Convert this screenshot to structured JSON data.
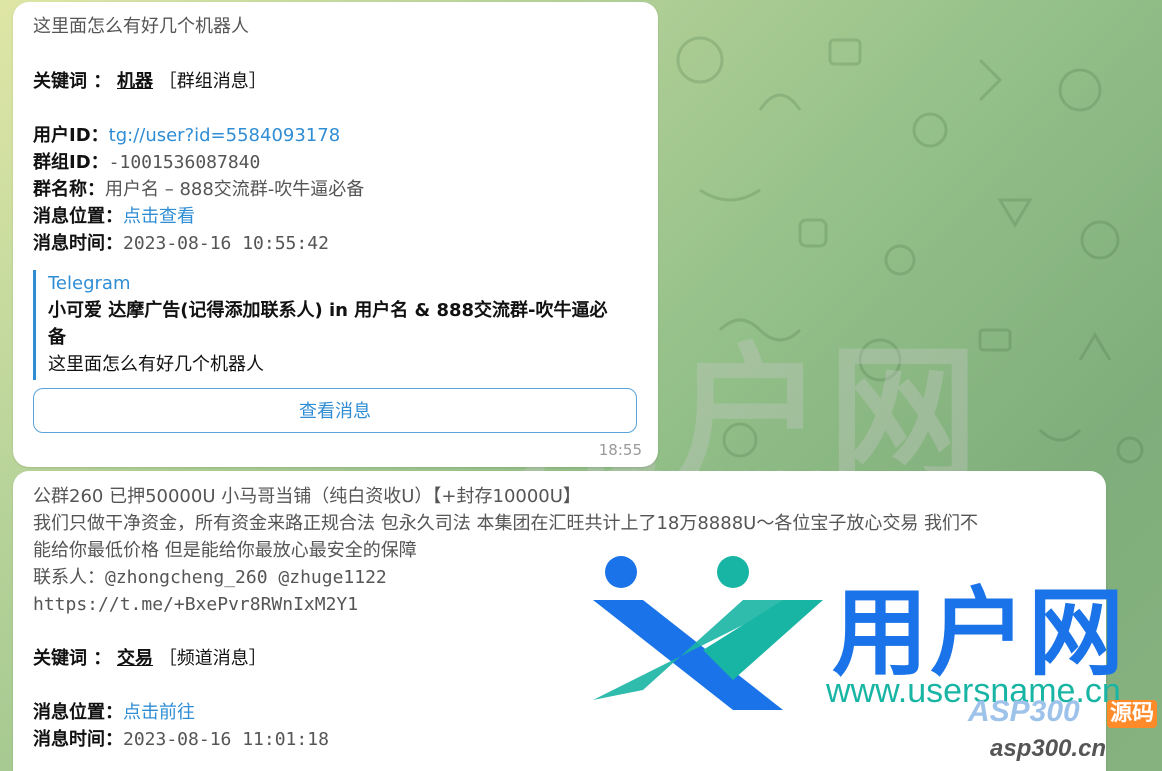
{
  "msg1": {
    "text": "这里面怎么有好几个机器人",
    "kw_label": "关键词 ：",
    "kw_value": "机器",
    "kw_type": "［群组消息］",
    "uid_label": "用户ID：",
    "uid_value": "tg://user?id=5584093178",
    "gid_label": "群组ID：",
    "gid_value": "-1001536087840",
    "gname_label": "群名称：",
    "gname_value": "用户名 – 888交流群-吹牛逼必备",
    "pos_label": "消息位置：",
    "pos_value": "点击查看",
    "time_label": "消息时间：",
    "time_value": "2023-08-16 10:55:42",
    "quote_title": "Telegram",
    "quote_line1": "小可爱 达摩广告(记得添加联系人) in 用户名 & 888交流群-吹牛逼必",
    "quote_line2": "备",
    "quote_text": "这里面怎么有好几个机器人",
    "button": "查看消息",
    "timestamp": "18:55"
  },
  "msg2": {
    "line1": "公群260 已押50000U 小马哥当铺（纯白资收U）【+封存10000U】",
    "line2": "我们只做干净资金，所有资金来路正规合法 包永久司法 本集团在汇旺共计上了18万8888U～各位宝子放心交易 我们不",
    "line3": "能给你最低价格 但是能给你最放心最安全的保障",
    "line4": "联系人：@zhongcheng_260 @zhuge1122",
    "line5": "https://t.me/+BxePvr8RWnIxM2Y1",
    "kw_label": "关键词 ：",
    "kw_value": "交易",
    "kw_type": "［频道消息］",
    "pos_label": "消息位置：",
    "pos_value": "点击前往",
    "time_label": "消息时间：",
    "time_value": "2023-08-16 11:01:18"
  },
  "watermark": {
    "big": "用户网",
    "url": "www.usersname.cn",
    "logo_text": "用户网",
    "logo_url": "www.usersname.cn",
    "asp": "ASP300",
    "asp_badge": "源码",
    "asp_url": "asp300.cn"
  },
  "colors": {
    "link": "#2f8dd4",
    "logo_blue": "#1a73e8",
    "logo_teal": "#19b5a4"
  }
}
